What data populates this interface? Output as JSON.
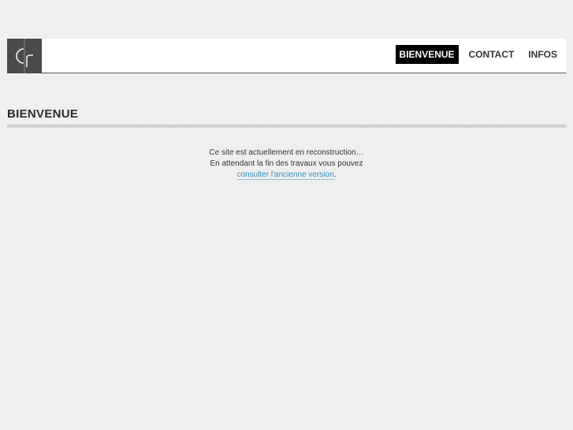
{
  "header": {
    "logo_icon": "cr-monogram-logo",
    "nav": [
      {
        "label": "BIENVENUE",
        "active": true
      },
      {
        "label": "CONTACT",
        "active": false
      },
      {
        "label": "INFOS",
        "active": false
      }
    ]
  },
  "main": {
    "title": "BIENVENUE",
    "line1": "Ce site est actuellement en reconstruction…",
    "line2": "En attendant la fin des travaux vous pouvez",
    "link_text": "consulter l'ancienne version",
    "link_suffix": "."
  },
  "colors": {
    "background": "#efefef",
    "header_bg": "#ffffff",
    "logo_bg": "#4a4a4a",
    "active_nav_bg": "#000000",
    "link": "#2f8fc6"
  }
}
